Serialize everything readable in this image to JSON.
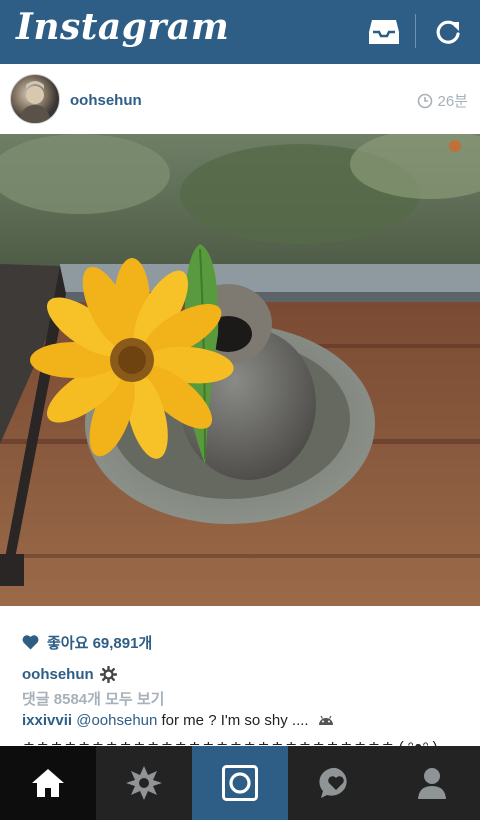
{
  "app": {
    "logo_text": "Instagram",
    "brand_color": "#2e5e86"
  },
  "topbar": {
    "icons": [
      "inbox-icon",
      "refresh-icon"
    ]
  },
  "post": {
    "username": "oohsehun",
    "time": "26분",
    "likes_text": "좋아요 69,891개",
    "caption_user": "oohsehun",
    "view_comments": "댓글 8584개 모두 보기",
    "comment": {
      "user": "ixxivvii",
      "mention": "@oohsehun",
      "text": " for me ? I'm so shy ....",
      "second_line": "ㅎㅎㅎㅎㅎㅎㅎㅎㅎㅎㅎㅎㅎㅎㅎㅎㅎㅎㅎㅎㅎㅎㅎㅎㅎㅎㅎ ( ᵔᴥᵔ )"
    }
  },
  "bottom_nav": [
    {
      "name": "home",
      "icon": "home-icon"
    },
    {
      "name": "explore",
      "icon": "explore-star-icon"
    },
    {
      "name": "camera",
      "icon": "camera-icon"
    },
    {
      "name": "news",
      "icon": "heart-bubble-icon"
    },
    {
      "name": "profile",
      "icon": "profile-icon"
    }
  ]
}
